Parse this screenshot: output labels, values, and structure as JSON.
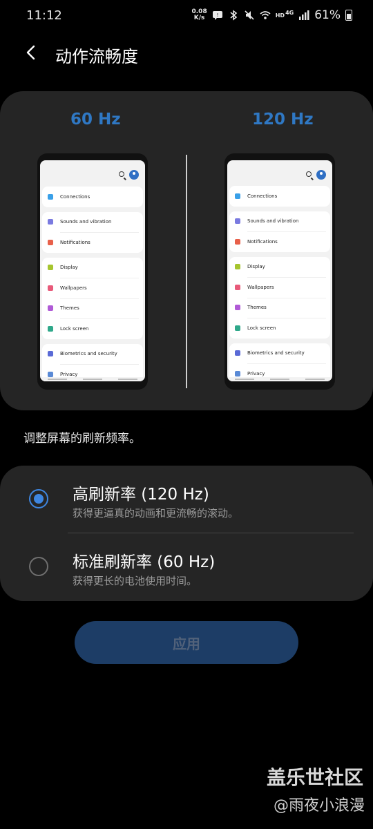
{
  "status_bar": {
    "time": "11:12",
    "net_speed_value": "0.08",
    "net_speed_unit": "K/s",
    "hd_label": "HD",
    "network_label": "4G",
    "battery": "61%",
    "icons": [
      "chat-icon",
      "bluetooth-icon",
      "mute-icon",
      "wifi-icon",
      "signal-icon",
      "battery-icon"
    ]
  },
  "header": {
    "title": "动作流畅度"
  },
  "preview": {
    "left_label": "60 Hz",
    "right_label": "120 Hz",
    "settings_items": [
      {
        "label": "Connections",
        "color": "#3aa0e8"
      },
      {
        "label": "Sounds and vibration",
        "color": "#7a7ae0"
      },
      {
        "label": "Notifications",
        "color": "#e8604a"
      },
      {
        "label": "Display",
        "color": "#a6c52f"
      },
      {
        "label": "Wallpapers",
        "color": "#e85a7a"
      },
      {
        "label": "Themes",
        "color": "#b05ad6"
      },
      {
        "label": "Lock screen",
        "color": "#2fa88a"
      },
      {
        "label": "Biometrics and security",
        "color": "#5a6ad6"
      },
      {
        "label": "Privacy",
        "color": "#5a8ad6"
      }
    ]
  },
  "description": "调整屏幕的刷新频率。",
  "options": [
    {
      "title": "高刷新率 (120 Hz)",
      "subtitle": "获得更逼真的动画和更流畅的滚动。",
      "selected": true
    },
    {
      "title": "标准刷新率 (60 Hz)",
      "subtitle": "获得更长的电池使用时间。",
      "selected": false
    }
  ],
  "apply_label": "应用",
  "watermark": {
    "line1": "盖乐世社区",
    "line2": "@雨夜小浪漫"
  },
  "colors": {
    "accent": "#3e86e0",
    "hz_label": "#2f78c4",
    "card_bg": "#252525",
    "apply_bg": "#1d3d66"
  }
}
